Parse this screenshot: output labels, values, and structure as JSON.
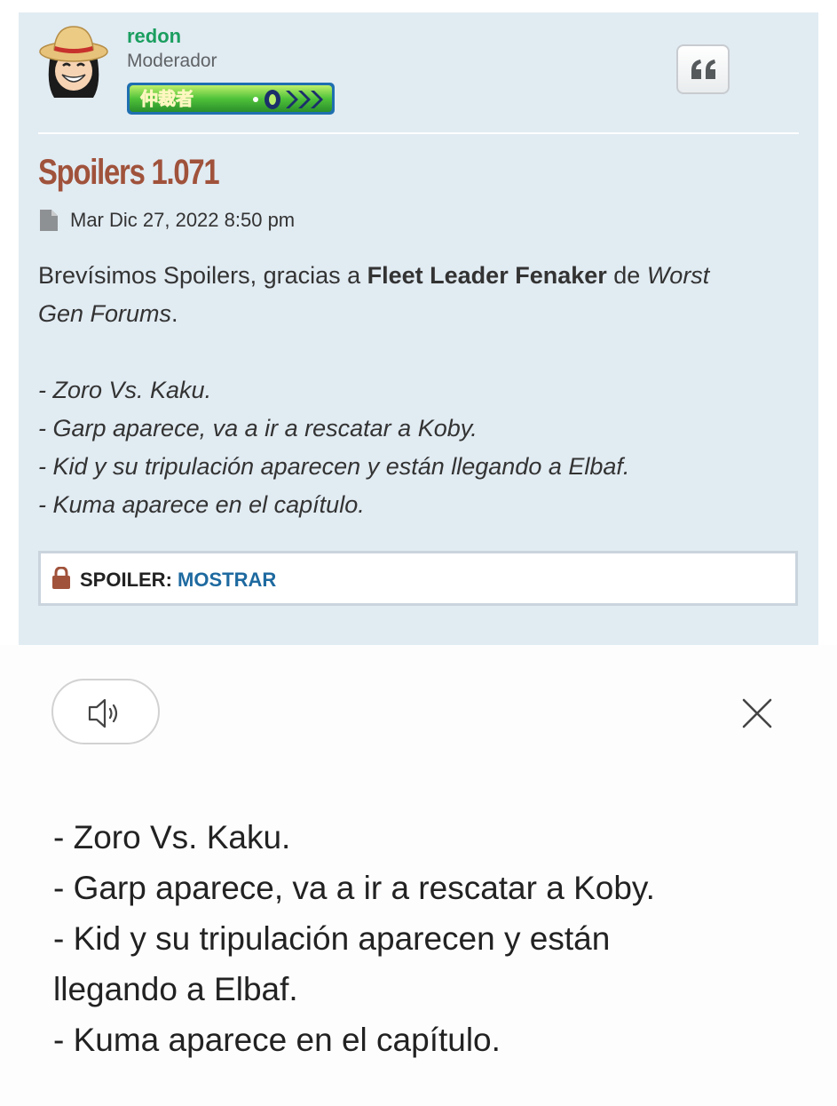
{
  "post": {
    "author": {
      "name": "redon",
      "rank": "Moderador",
      "badge_text": "仲裁者"
    },
    "title": "Spoilers 1.071",
    "date": "Mar Dic 27, 2022 8:50 pm",
    "intro": {
      "part1": "Brevísimos Spoilers, gracias a ",
      "bold": "Fleet Leader Fenaker",
      "part2": " de ",
      "italic_1": "Worst",
      "italic_2": "Gen Forums",
      "part3": "."
    },
    "list": [
      "- Zoro Vs. Kaku.",
      "- Garp aparece, va a ir a rescatar a Koby.",
      "- Kid y su tripulación aparecen y están llegando a Elbaf.",
      "- Kuma aparece en el capítulo."
    ],
    "spoiler": {
      "label": "SPOILER:",
      "toggle": "MOSTRAR"
    }
  },
  "reader": {
    "lines": [
      "- Zoro Vs. Kaku.",
      "- Garp aparece, va a ir a rescatar a Koby.",
      "- Kid y su tripulación aparecen y están",
      "llegando a Elbaf.",
      "- Kuma aparece en el capítulo."
    ]
  },
  "colors": {
    "post_bg": "#e1ebf2",
    "author": "#1a9e5f",
    "title": "#a0523b",
    "spoiler_toggle": "#1e6aa0",
    "lock": "#a0523b"
  },
  "icons": {
    "avatar": "avatar-straw-hat",
    "quote": "quote-icon",
    "date": "document-icon",
    "lock": "lock-icon",
    "speaker": "speaker-icon",
    "close": "close-icon"
  }
}
